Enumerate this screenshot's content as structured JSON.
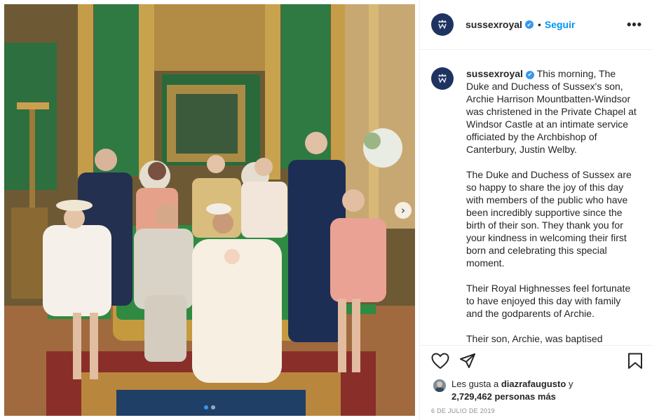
{
  "post": {
    "account": {
      "username": "sussexroyal",
      "verified_glyph": "✔",
      "follow_label": "Seguir",
      "separator": "•",
      "more_glyph": "•••"
    },
    "media": {
      "carousel_total": 2,
      "carousel_active": 1,
      "next_glyph": "›"
    },
    "caption": {
      "username": "sussexroyal",
      "paragraphs": [
        "This morning, The Duke and Duchess of Sussex's son, Archie Harrison Mountbatten-Windsor was christened in the Private Chapel at Windsor Castle at an intimate service officiated by the Archbishop of Canterbury, Justin Welby.",
        "The Duke and Duchess of Sussex are so happy to share the joy of this day with members of the public who have been incredibly supportive since the birth of their son. They thank you for your kindness in welcoming their first born and celebrating this special moment.",
        "Their Royal Highnesses feel fortunate to have enjoyed this day with family and the godparents of Archie.",
        "Their son, Archie, was baptised"
      ]
    },
    "likes": {
      "prefix": "Les gusta a",
      "user": "diazrafaugusto",
      "connector": "y",
      "count": "2,729,462",
      "suffix": "personas más"
    },
    "date": "6 DE JULIO DE 2019"
  },
  "icons": {
    "avatar": "monogram-crest-icon",
    "like": "heart-outline-icon",
    "share": "paper-plane-icon",
    "save": "bookmark-outline-icon",
    "next": "chevron-right-icon"
  },
  "colors": {
    "link_blue": "#0095f6",
    "verified_blue": "#3897f0",
    "avatar_navy": "#1f3360",
    "text": "#262626",
    "muted": "#8e8e8e",
    "border": "#efefef"
  }
}
